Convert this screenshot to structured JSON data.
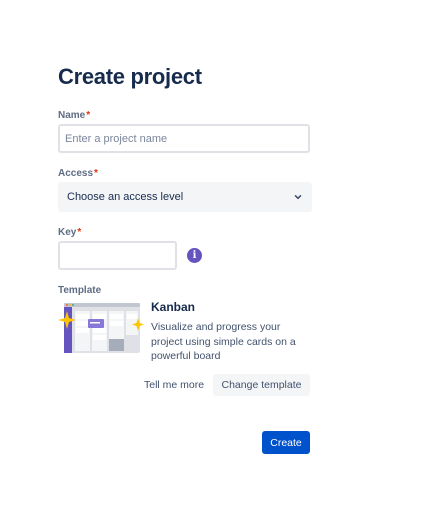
{
  "form": {
    "title": "Create project",
    "required_marker": "*",
    "name": {
      "label": "Name",
      "placeholder": "Enter a project name"
    },
    "access": {
      "label": "Access",
      "selected": "Choose an access level"
    },
    "key": {
      "label": "Key",
      "info_glyph": "i"
    },
    "template": {
      "label": "Template",
      "name": "Kanban",
      "description": "Visualize and progress your project using simple cards on a powerful board",
      "tell_more": "Tell me more",
      "change": "Change template"
    },
    "create": "Create"
  },
  "colors": {
    "primary": "#0052cc",
    "required": "#de350b",
    "info": "#6554c0",
    "heading": "#172b4d"
  },
  "icons": {
    "select": "chevron-down-icon",
    "key_help": "info-icon",
    "template": "kanban-board-illustration"
  }
}
